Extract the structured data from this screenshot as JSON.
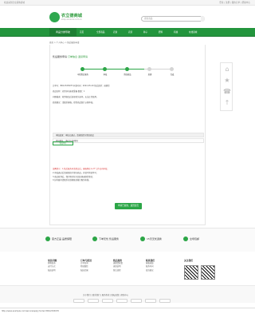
{
  "topbar": {
    "left": "欢迎来到企业采购商城",
    "right": "登录 | 注册 | 我的订单 | 帮助中心"
  },
  "header": {
    "logo_name": "农立德商城",
    "logo_sub": "shop.xxxxxxx.com.cn",
    "search_placeholder": "搜索商品"
  },
  "nav": {
    "category": "商品分类导航",
    "items": [
      "首页",
      "全部商品",
      "农资",
      "农药",
      "种子",
      "肥料",
      "机械",
      "在线商城"
    ]
  },
  "breadcrumb": "首页 > 个人中心 > 售后服务申请",
  "main": {
    "title": "售后服务申请",
    "title_tag1": "订单信息",
    "title_tag2": "退货申请",
    "steps": [
      "申请售后服务",
      "审核",
      "寄回商品",
      "处理",
      "完成"
    ],
    "para1": "订单号：BR12345678  申请时间：2024-05-20  售后类型：退换货",
    "para2": "商品名称：农用多功能喷雾器  数量：1",
    "para3": "问题描述：收到商品后发现喷头损坏，无法正常使用。",
    "para4": "处理建议：请联系客服，提供商品照片以便审核。",
    "row1": "审核结果：审核已通过，请按照提示寄回商品",
    "row2": "寄回地址：请在7日内寄回",
    "box_label": "物流单号",
    "notes": [
      "温馨提示：1.售后服务申请提交后，客服将在1-2个工作日内审核；",
      "2.审核通过后请按照指引寄回商品，并填写物流单号；",
      "3.商品收到后，我们将尽快为您处理退换货事宜；",
      "4.如有疑问请联系在线客服或拨打服务热线。"
    ],
    "cta": "申请已提交，返回首页"
  },
  "features": [
    "官方正品 品质保障",
    "下单无忧 售后服务",
    "15天无忧退换",
    "全场包邮"
  ],
  "footer": {
    "cols": [
      {
        "h": "常见问题",
        "items": [
          "购物指南",
          "支付方式",
          "配送说明"
        ]
      },
      {
        "h": "订单与配送",
        "items": [
          "订单查询",
          "物流跟踪",
          "配送范围"
        ]
      },
      {
        "h": "售后服务",
        "items": [
          "退换货政策",
          "退款说明",
          "售后流程"
        ]
      },
      {
        "h": "联系我们",
        "items": [
          "客服热线",
          "服务时间",
          "投诉建议"
        ]
      },
      {
        "h": "关注我们",
        "items": [
          "微信公众号",
          "手机商城"
        ]
      }
    ]
  },
  "bottom_links": "关于我们 | 联系我们 | 服务条款 | 隐私政策 | 帮助中心",
  "status": "http://www.example.com/service/apply?order=BR12345678"
}
